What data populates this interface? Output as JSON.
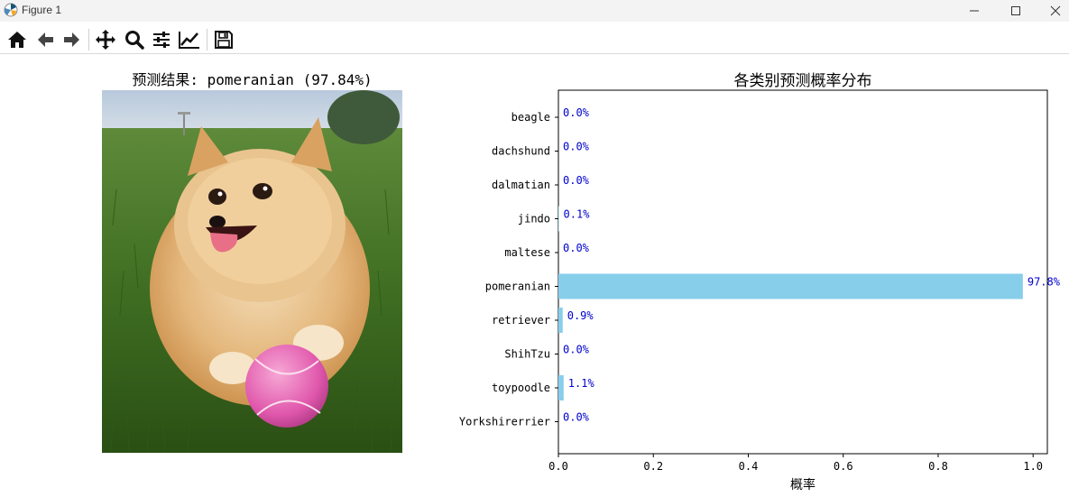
{
  "window": {
    "title": "Figure 1",
    "minimize_icon": "minimize-icon",
    "maximize_icon": "maximize-icon",
    "close_icon": "close-icon"
  },
  "toolbar": {
    "buttons": [
      {
        "name": "home",
        "icon": "home-icon"
      },
      {
        "name": "back",
        "icon": "arrow-left-icon"
      },
      {
        "name": "forward",
        "icon": "arrow-right-icon"
      },
      {
        "name": "pan",
        "icon": "move-icon"
      },
      {
        "name": "zoom",
        "icon": "magnifier-icon"
      },
      {
        "name": "configure-subplots",
        "icon": "sliders-icon"
      },
      {
        "name": "edit-axis",
        "icon": "line-chart-icon"
      },
      {
        "name": "save",
        "icon": "floppy-disk-icon"
      }
    ]
  },
  "left_panel": {
    "title": "预测结果: pomeranian (97.84%)"
  },
  "chart_data": {
    "type": "bar",
    "orientation": "horizontal",
    "title": "各类别预测概率分布",
    "xlabel": "概率",
    "ylabel": "",
    "xlim": [
      0,
      1.03
    ],
    "xticks": [
      "0.0",
      "0.2",
      "0.4",
      "0.6",
      "0.8",
      "1.0"
    ],
    "categories": [
      "beagle",
      "dachshund",
      "dalmatian",
      "jindo",
      "maltese",
      "pomeranian",
      "retriever",
      "ShihTzu",
      "toypoodle",
      "Yorkshirerrier"
    ],
    "values": [
      0.0,
      0.0,
      0.0,
      0.001,
      0.0,
      0.9784,
      0.009,
      0.0,
      0.011,
      0.0
    ],
    "labels": [
      "0.0%",
      "0.0%",
      "0.0%",
      "0.1%",
      "0.0%",
      "97.8%",
      "0.9%",
      "0.0%",
      "1.1%",
      "0.0%"
    ],
    "bar_color": "#87ceeb",
    "label_color": "#0000cd"
  }
}
